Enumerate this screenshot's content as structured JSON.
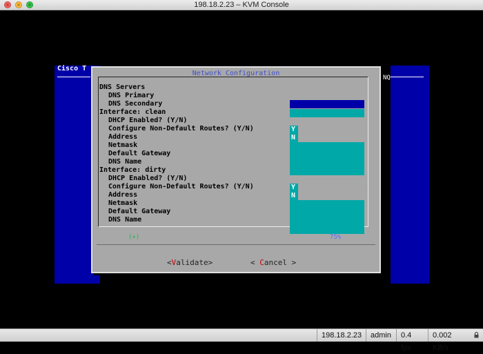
{
  "window": {
    "title": "198.18.2.23 – KVM Console"
  },
  "background": {
    "app_title": "Cisco T",
    "right_tag": "NQ"
  },
  "dialog": {
    "title": "Network Configuration",
    "rows": [
      "DNS Servers",
      "DNS Primary",
      "DNS Secondary",
      "Interface: clean",
      "DHCP Enabled? (Y/N)",
      "Configure Non-Default Routes? (Y/N)",
      "Address",
      "Netmask",
      "Default Gateway",
      "DNS Name",
      "Interface: dirty",
      "DHCP Enabled? (Y/N)",
      "Configure Non-Default Routes? (Y/N)",
      "Address",
      "Netmask",
      "Default Gateway",
      "DNS Name"
    ],
    "values": {
      "clean_dhcp": "Y",
      "clean_routes": "N",
      "dirty_dhcp": "Y",
      "dirty_routes": "N"
    },
    "scroll_left": "(+)",
    "scroll_right": "75%",
    "buttons": {
      "validate_prefix": "<",
      "validate_hot": "V",
      "validate_rest": "alidate>",
      "cancel_prefix": "< ",
      "cancel_hot": "C",
      "cancel_rest": "ancel >"
    }
  },
  "statusbar": {
    "host": "198.18.2.23",
    "user": "admin",
    "fps": "0.4 fps",
    "rate": "0.002 KB/s"
  },
  "colors": {
    "field": "#00a8a8",
    "console_blue": "#0000a8",
    "dialog": "#a8a8a8"
  }
}
